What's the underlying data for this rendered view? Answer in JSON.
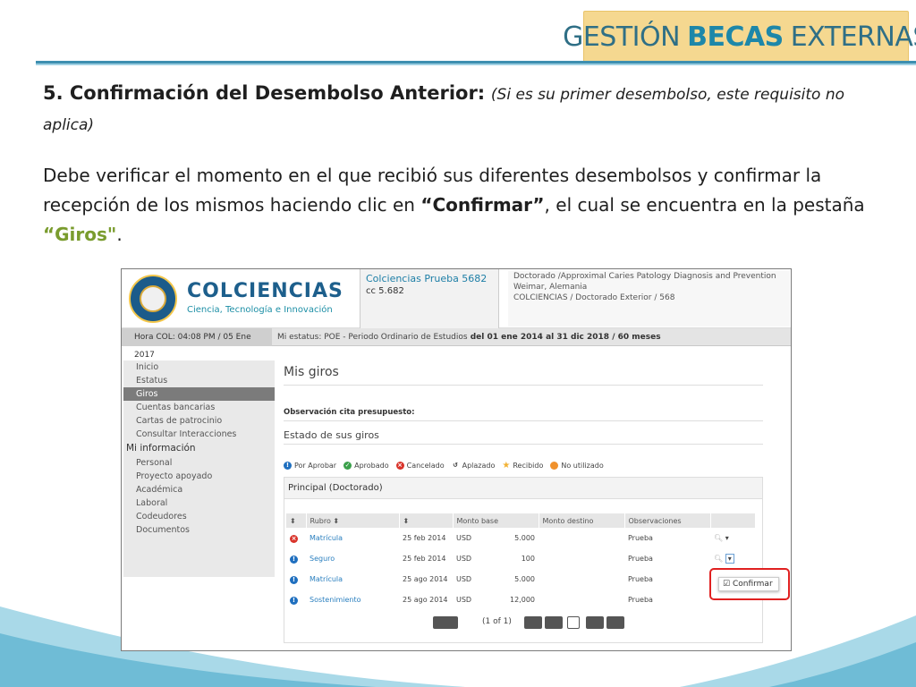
{
  "brand": {
    "part1": "GESTIÓN",
    "part2": "BECAS",
    "part3": "EXTERNAS"
  },
  "slide": {
    "title_bold": "5. Confirmación del Desembolso Anterior:",
    "title_italic": "(Si es su primer desembolso, este requisito no aplica)",
    "body_1": "Debe verificar el momento en el que recibió sus diferentes desembolsos y confirmar la recepción de los mismos haciendo clic en ",
    "body_confirmar": "“Confirmar”",
    "body_2": ", el cual se encuentra en la pestaña ",
    "body_giros": "“Giros\"",
    "body_3": "."
  },
  "app": {
    "logo_name": "COLCIENCIAS",
    "logo_sub": "Ciencia, Tecnología e Innovación",
    "user_name": "Colciencias Prueba 5682",
    "user_cc": "cc 5.682",
    "program_line1": "Doctorado /Approximal Caries Patology Diagnosis and Prevention",
    "program_line2": "Weimar, Alemania",
    "program_line3": "COLCIENCIAS / Doctorado Exterior / 568",
    "hora": "Hora COL: 04:08 PM / 05 Ene 2017",
    "estatus_prefix": "Mi estatus: POE - Periodo Ordinario de Estudios",
    "estatus_range": " del  01 ene 2014  al  31 dic 2018 / 60 meses"
  },
  "sidebar": {
    "items": [
      {
        "label": "Inicio",
        "active": false
      },
      {
        "label": "Estatus",
        "active": false
      },
      {
        "label": "Giros",
        "active": true
      },
      {
        "label": "Cuentas bancarias",
        "active": false
      },
      {
        "label": "Cartas de patrocinio",
        "active": false
      },
      {
        "label": "Consultar Interacciones",
        "active": false
      }
    ],
    "section_head": "Mi información",
    "section_items": [
      "Personal",
      "Proyecto apoyado",
      "Académica",
      "Laboral",
      "Codeudores",
      "Documentos"
    ]
  },
  "main": {
    "title": "Mis giros",
    "observacion": "Observación cita presupuesto:",
    "estado": "Estado de sus giros",
    "legend": [
      {
        "label": "Por Aprobar",
        "color": "#1f6fbf",
        "icon": "info-icon"
      },
      {
        "label": "Aprobado",
        "color": "#3aa04a",
        "icon": "check-icon"
      },
      {
        "label": "Cancelado",
        "color": "#d9342b",
        "icon": "cancel-icon"
      },
      {
        "label": "Aplazado",
        "color": "#333333",
        "icon": "undo-icon"
      },
      {
        "label": "Recibido",
        "color": "#f2b233",
        "icon": "star-icon"
      },
      {
        "label": "No utilizado",
        "color": "#f0912c",
        "icon": "circle-icon"
      }
    ],
    "panel_title": "Principal (Doctorado)",
    "columns": [
      "Rubro",
      "",
      "Monto base",
      "Monto destino",
      "Observaciones"
    ],
    "rows": [
      {
        "status": "cancel",
        "rubro": "Matrícula",
        "fecha": "25 feb 2014",
        "moneda": "USD",
        "monto": "5.000",
        "obs": "Prueba"
      },
      {
        "status": "info",
        "rubro": "Seguro",
        "fecha": "25 feb 2014",
        "moneda": "USD",
        "monto": "100",
        "obs": "Prueba"
      },
      {
        "status": "info",
        "rubro": "Matrícula",
        "fecha": "25 ago 2014",
        "moneda": "USD",
        "monto": "5.000",
        "obs": "Prueba"
      },
      {
        "status": "info",
        "rubro": "Sostenimiento",
        "fecha": "25 ago 2014",
        "moneda": "USD",
        "monto": "12,000",
        "obs": "Prueba"
      }
    ],
    "pager_text": "(1 of 1)",
    "confirm_label": "Confirmar"
  }
}
